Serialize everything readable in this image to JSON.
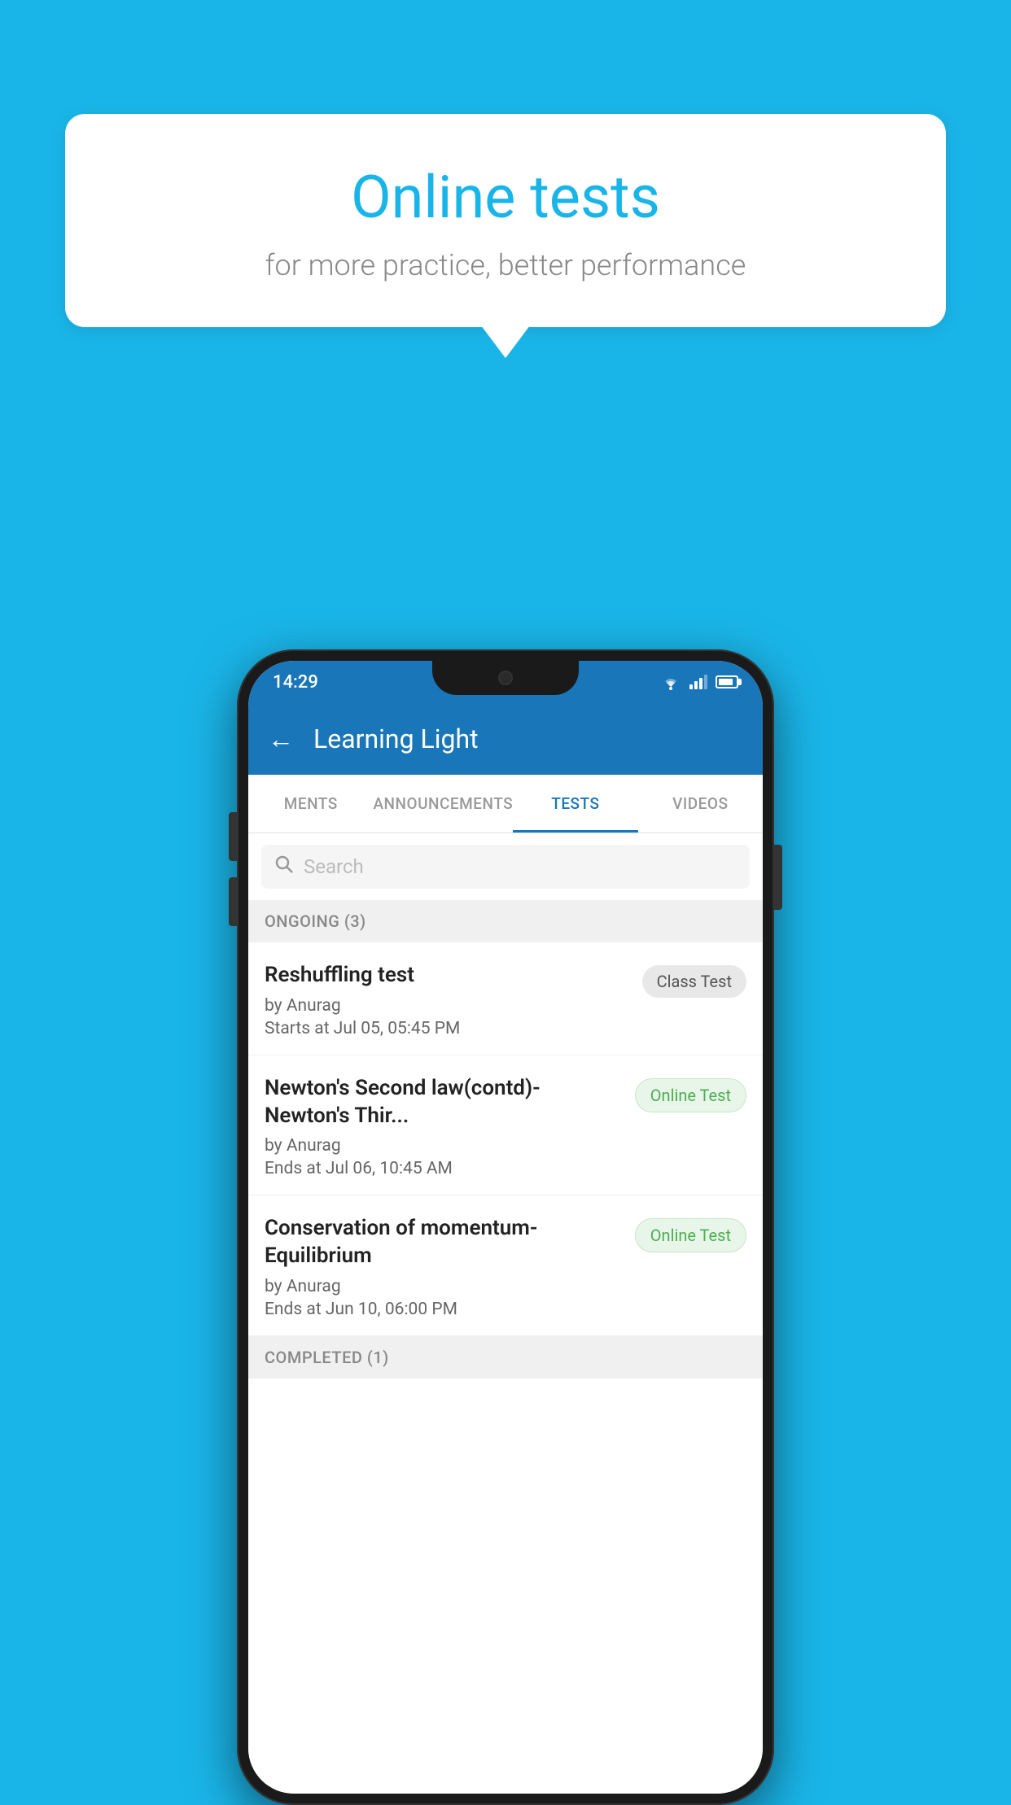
{
  "background_color": "#1ab5e8",
  "speech_bubble": {
    "title": "Online tests",
    "subtitle": "for more practice, better performance"
  },
  "phone": {
    "status_bar": {
      "time": "14:29"
    },
    "app_bar": {
      "title": "Learning Light",
      "back_label": "←"
    },
    "tabs": [
      {
        "label": "MENTS",
        "active": false
      },
      {
        "label": "ANNOUNCEMENTS",
        "active": false
      },
      {
        "label": "TESTS",
        "active": true
      },
      {
        "label": "VIDEOS",
        "active": false
      }
    ],
    "search": {
      "placeholder": "Search"
    },
    "section_ongoing": "ONGOING (3)",
    "tests": [
      {
        "name": "Reshuffling test",
        "author": "by Anurag",
        "date": "Starts at  Jul 05, 05:45 PM",
        "badge": "Class Test",
        "badge_type": "class"
      },
      {
        "name": "Newton's Second law(contd)-Newton's Thir...",
        "author": "by Anurag",
        "date": "Ends at  Jul 06, 10:45 AM",
        "badge": "Online Test",
        "badge_type": "online"
      },
      {
        "name": "Conservation of momentum-Equilibrium",
        "author": "by Anurag",
        "date": "Ends at  Jun 10, 06:00 PM",
        "badge": "Online Test",
        "badge_type": "online"
      }
    ],
    "section_completed": "COMPLETED (1)"
  }
}
